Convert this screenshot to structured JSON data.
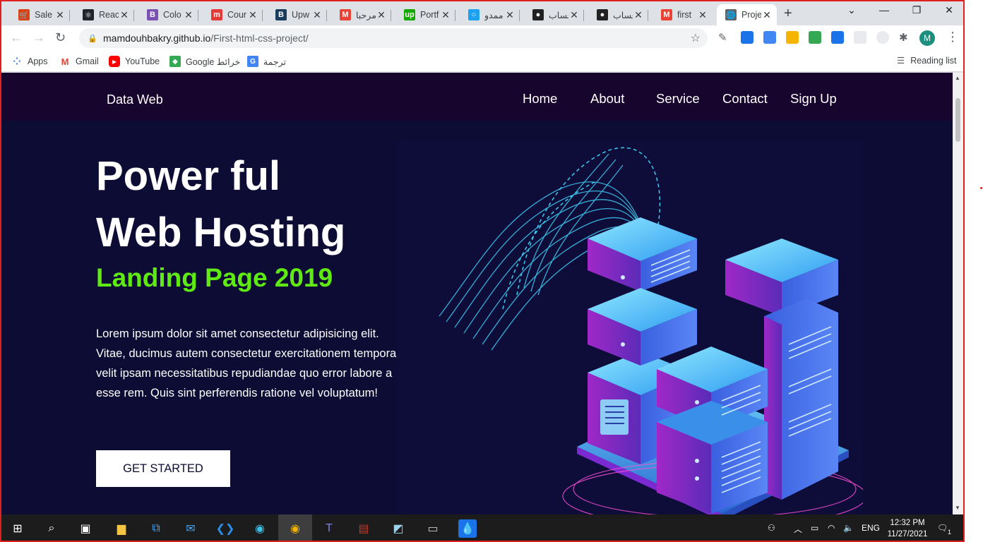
{
  "browser": {
    "tabs": [
      {
        "title": "Sale",
        "color": "#d84315",
        "glyph": "🛒"
      },
      {
        "title": "React",
        "color": "#20232a",
        "glyph": "⚛"
      },
      {
        "title": "Colo",
        "color": "#7952b3",
        "glyph": "B"
      },
      {
        "title": "Cour",
        "color": "#e53935",
        "glyph": "m"
      },
      {
        "title": "Upw",
        "color": "#1a3b5c",
        "glyph": "B"
      },
      {
        "title": "مرحبا",
        "color": "#ea4335",
        "glyph": "M"
      },
      {
        "title": "Portf",
        "color": "#14a800",
        "glyph": "up"
      },
      {
        "title": "ممدو",
        "color": "#1da1f2",
        "glyph": "○"
      },
      {
        "title": "حساب",
        "color": "#222222",
        "glyph": "●"
      },
      {
        "title": "حساب",
        "color": "#222222",
        "glyph": "●"
      },
      {
        "title": "first",
        "color": "#ea4335",
        "glyph": "M"
      },
      {
        "title": "Proje",
        "color": "#5f6368",
        "glyph": "🌐"
      }
    ],
    "active_tab": 11,
    "url_host": "mamdouhbakry.github.io",
    "url_path": "/First-html-css-project/",
    "avatar_letter": "M",
    "bookmarks": [
      {
        "label": "Apps"
      },
      {
        "label": "Gmail"
      },
      {
        "label": "YouTube"
      },
      {
        "label": "Google خرائط"
      },
      {
        "label": "ترجمة"
      }
    ],
    "reading_list": "Reading list"
  },
  "site": {
    "brand": "Data Web",
    "nav": [
      "Home",
      "About",
      "Service",
      "Contact",
      "Sign Up"
    ],
    "hero": {
      "line1": "Power ful",
      "line2": "Web Hosting",
      "subtitle": "Landing Page 2019",
      "body": "Lorem ipsum dolor sit amet consectetur adipisicing elit. Vitae, ducimus autem consectetur exercitationem tempora velit ipsam necessitatibus repudiandae quo error labore a esse rem. Quis sint perferendis ratione vel voluptatum!",
      "cta": "GET STARTED"
    },
    "colors": {
      "nav_bg": "#17052e",
      "hero_bg": "#0d0c35",
      "accent": "#60ea13"
    }
  },
  "taskbar": {
    "language": "ENG",
    "time": "12:32 PM",
    "date": "11/27/2021",
    "notification_count": "1"
  }
}
